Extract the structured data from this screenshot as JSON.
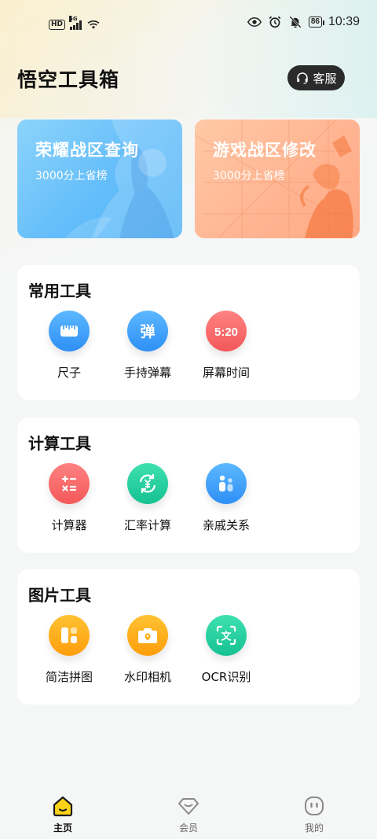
{
  "status_bar": {
    "network_badge": "HD",
    "network_type": "5G",
    "battery": "86",
    "time": "10:39"
  },
  "header": {
    "title": "悟空工具箱",
    "service_button": "客服"
  },
  "banners": [
    {
      "title": "荣耀战区查询",
      "subtitle": "3000分上省榜"
    },
    {
      "title": "游戏战区修改",
      "subtitle": "3000分上省榜"
    }
  ],
  "sections": [
    {
      "title": "常用工具",
      "tools": [
        {
          "label": "尺子",
          "icon": "ruler-icon"
        },
        {
          "label": "手持弹幕",
          "icon": "danmaku-icon",
          "glyph": "弹"
        },
        {
          "label": "屏幕时间",
          "icon": "clock-display-icon",
          "glyph": "5:20"
        }
      ]
    },
    {
      "title": "计算工具",
      "tools": [
        {
          "label": "计算器",
          "icon": "calculator-icon"
        },
        {
          "label": "汇率计算",
          "icon": "exchange-rate-icon"
        },
        {
          "label": "亲戚关系",
          "icon": "family-icon"
        }
      ]
    },
    {
      "title": "图片工具",
      "tools": [
        {
          "label": "简洁拼图",
          "icon": "collage-icon"
        },
        {
          "label": "水印相机",
          "icon": "camera-icon"
        },
        {
          "label": "OCR识别",
          "icon": "ocr-icon",
          "glyph": "文"
        }
      ]
    }
  ],
  "tabbar": {
    "items": [
      {
        "label": "主页",
        "icon": "home-icon",
        "active": true
      },
      {
        "label": "会员",
        "icon": "diamond-icon",
        "active": false
      },
      {
        "label": "我的",
        "icon": "profile-icon",
        "active": false
      }
    ]
  },
  "colors": {
    "accent_yellow": "#ffd21a",
    "blue": "#3a9af7",
    "red": "#f76565",
    "green": "#22cc9c",
    "orange": "#ffac14"
  }
}
